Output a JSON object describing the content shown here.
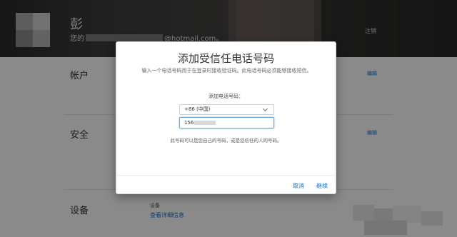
{
  "header": {
    "name": "彭",
    "email_prefix": "您的",
    "email_domain": "@hotmail.com。",
    "logout": "注销"
  },
  "sections": {
    "account": {
      "title": "帐户",
      "edit": "编辑"
    },
    "security": {
      "title": "安全",
      "edit": "编辑"
    },
    "devices": {
      "title": "设备",
      "label": "设备",
      "link": "查看详细信息"
    }
  },
  "modal": {
    "title": "添加受信任电话号码",
    "description": "输入一个电话号码用于在登录时接收验证码。此电话号码必须能够接收短信。",
    "field_label": "添加电话号码：",
    "country_value": "+86 (中国)",
    "phone_value": "156",
    "hint": "此号码可以是您自己的号码，或是您信任的人的号码。",
    "cancel": "取消",
    "continue": "继续"
  },
  "colors": {
    "link": "#0a6fd1",
    "input_focus": "#5fa8e6"
  }
}
